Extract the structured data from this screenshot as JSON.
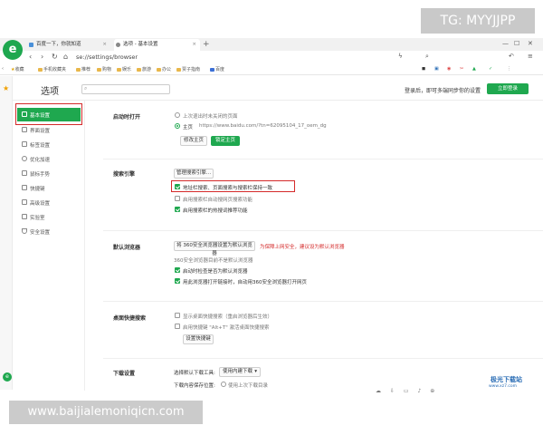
{
  "watermarks": {
    "top": "TG: MYYJJPP",
    "bottom": "www.baijialemoniqicn.com"
  },
  "browser": {
    "tabs": [
      {
        "label": "百度一下，你就知道"
      },
      {
        "label": "选项 - 基本设置"
      }
    ],
    "address": "se://settings/browser",
    "bookmarks": [
      "收藏",
      "手机收藏夹",
      "推荐",
      "购物",
      "娱乐",
      "旅游",
      "办公",
      "贾子指南",
      "百度"
    ]
  },
  "settings": {
    "title": "选项",
    "login_prompt": "登录后，即可多端同步你的设置",
    "login_button": "立即登录",
    "nav": [
      "基本设置",
      "界面设置",
      "标签设置",
      "优化加速",
      "鼠标手势",
      "快捷键",
      "高级设置",
      "实验室",
      "安全设置"
    ]
  },
  "sections": {
    "startup": {
      "label": "启动时打开",
      "option_last": "上次退出时未关闭的页面",
      "option_home": "主页",
      "home_url": "https://www.baidu.com/?tn=62095104_17_oem_dg",
      "btn_modify": "修改主页",
      "btn_locked": "锁定主页"
    },
    "search": {
      "label": "搜索引擎",
      "btn_manage": "管理搜索引擎...",
      "opt_sync": "地址栏搜索、页面搜索与搜索栏保持一致",
      "opt_auto": "启用搜索栏自动搜网页搜索功能",
      "opt_hot": "启用搜索栏的热搜词推荐功能"
    },
    "default_browser": {
      "label": "默认浏览器",
      "btn_set": "将 360安全浏览器设置为默认浏览器",
      "warning": "为保障上网安全，建议设为默认浏览器",
      "status": "360安全浏览器目前不是默认浏览器",
      "opt_check": "启动时检查是否为默认浏览器",
      "opt_open": "用此浏览器打开链接时，自动用360安全浏览器打开网页"
    },
    "desktop_search": {
      "label": "桌面快捷搜索",
      "opt_show": "显示桌面快捷搜索（重启浏览器后生效）",
      "opt_hotkey": "启用快捷键 \"Alt+T\" 激活桌面快捷搜索",
      "btn_settings": "设置快捷键"
    },
    "download": {
      "label": "下载设置",
      "choose_label": "选择默认下载工具:",
      "tool_selected": "使用内建下载",
      "save_label": "下载内容保存位置:",
      "save_opt": "使用上次下载目录"
    }
  },
  "site_logo": {
    "title": "极光下载站",
    "url": "www.xz7.com"
  }
}
